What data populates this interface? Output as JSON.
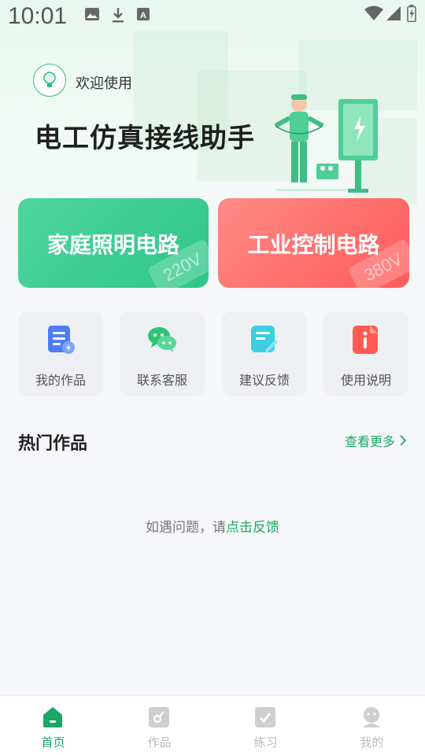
{
  "status_bar": {
    "time": "10:01",
    "icons": [
      "image-icon",
      "download-icon",
      "a-icon",
      "wifi-icon",
      "signal-icon",
      "battery-icon"
    ]
  },
  "header": {
    "welcome": "欢迎使用",
    "title": "电工仿真接线助手"
  },
  "circuit_cards": [
    {
      "label": "家庭照明电路",
      "voltage": "220V",
      "color": "#34c98c"
    },
    {
      "label": "工业控制电路",
      "voltage": "380V",
      "color": "#ff6563"
    }
  ],
  "quick_actions": [
    {
      "label": "我的作品",
      "icon": "document-icon"
    },
    {
      "label": "联系客服",
      "icon": "chat-icon"
    },
    {
      "label": "建议反馈",
      "icon": "edit-icon"
    },
    {
      "label": "使用说明",
      "icon": "info-icon"
    }
  ],
  "hot_works": {
    "title": "热门作品",
    "see_more": "查看更多",
    "feedback_prefix": "如遇问题，请",
    "feedback_link": "点击反馈"
  },
  "tabbar": [
    {
      "label": "首页",
      "icon": "home-icon",
      "active": true
    },
    {
      "label": "作品",
      "icon": "works-icon",
      "active": false
    },
    {
      "label": "练习",
      "icon": "practice-icon",
      "active": false
    },
    {
      "label": "我的",
      "icon": "profile-icon",
      "active": false
    }
  ],
  "colors": {
    "accent": "#1aa867",
    "green_card": "#34c98c",
    "red_card": "#ff6563"
  }
}
